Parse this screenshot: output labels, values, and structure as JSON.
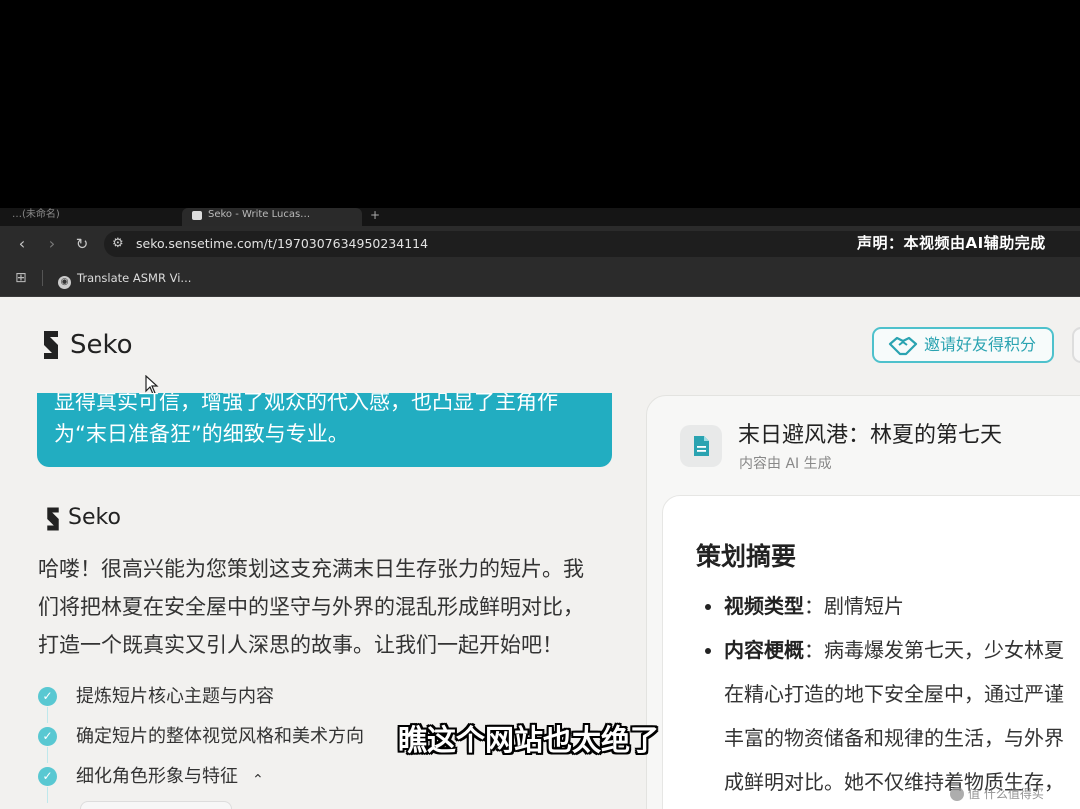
{
  "browser": {
    "tabs": [
      {
        "label": "…(未命名)"
      },
      {
        "label": "Seko - Write Lucas…"
      }
    ],
    "new_tab_glyph": "+",
    "url": "seko.sensetime.com/t/1970307634950234114",
    "bookmark": "Translate ASMR Vi..."
  },
  "overlay": {
    "disclaimer": "声明：本视频由AI辅助完成",
    "subtitle": "瞧这个网站也太绝了",
    "watermark": "值 什么值得买"
  },
  "app": {
    "logo_text": "Seko",
    "invite_label": "邀请好友得积分",
    "colors": {
      "accent": "#22adc1",
      "accent_border": "#4ec1cc"
    }
  },
  "chat": {
    "bubble_lines": [
      "显得真实可信，增强了观众的代入感，也凸显了主角作",
      "为“末日准备狂”的细致与专业。"
    ],
    "assistant_name": "Seko",
    "intro_lines": [
      "哈喽！很高兴能为您策划这支充满末日生存张力的短片。我",
      "们将把林夏在安全屋中的坚守与外界的混乱形成鲜明对比，",
      "打造一个既真实又引人深思的故事。让我们一起开始吧！"
    ],
    "steps": [
      {
        "label": "提炼短片核心主题与内容"
      },
      {
        "label": "确定短片的整体视觉风格和美术方向"
      },
      {
        "label": "细化角色形象与特征"
      }
    ]
  },
  "doc": {
    "title": "末日避风港：林夏的第七天",
    "subtitle": "内容由 AI 生成",
    "section_title": "策划摘要",
    "items": [
      {
        "key": "视频类型",
        "sep": "：",
        "value": "剧情短片"
      },
      {
        "key": "内容梗概",
        "sep": "：",
        "value": "病毒爆发第七天，少女林夏"
      }
    ],
    "continuation": [
      "在精心打造的地下安全屋中，通过严谨",
      "丰富的物资储备和规律的生活，与外界",
      "成鲜明对比。她不仅维持着物质生存，"
    ]
  }
}
